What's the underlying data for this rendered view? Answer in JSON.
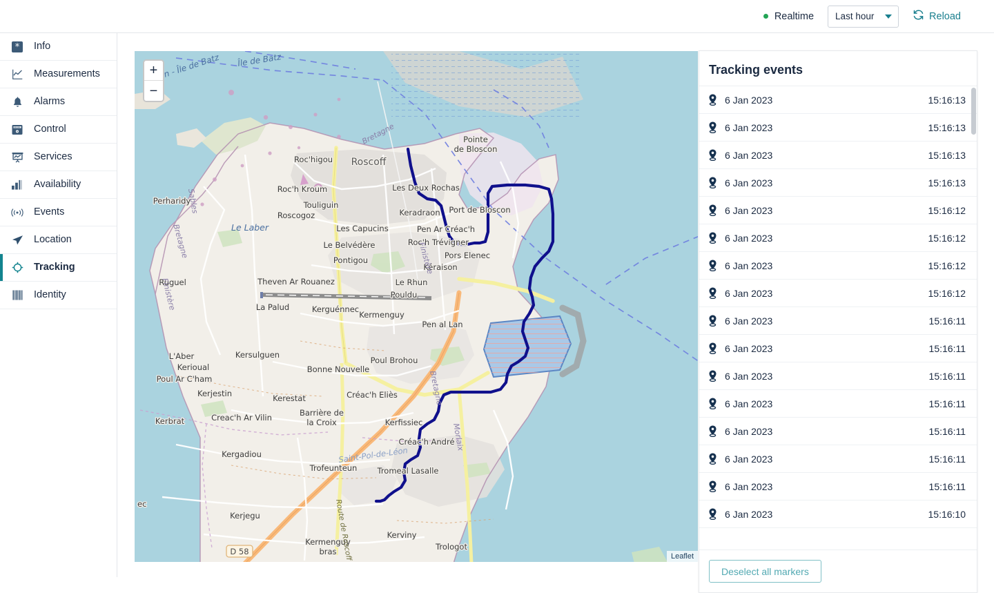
{
  "topbar": {
    "realtime_label": "Realtime",
    "realtime_status_color": "#23a455",
    "time_range_value": "Last hour",
    "reload_label": "Reload",
    "accent_color": "#1a7f8e"
  },
  "sidebar": {
    "active_item": "Tracking",
    "items": [
      {
        "label": "Info",
        "icon": "info-asterisk-icon"
      },
      {
        "label": "Measurements",
        "icon": "line-chart-icon"
      },
      {
        "label": "Alarms",
        "icon": "bell-icon"
      },
      {
        "label": "Control",
        "icon": "control-panel-icon"
      },
      {
        "label": "Services",
        "icon": "services-board-icon"
      },
      {
        "label": "Availability",
        "icon": "bar-chart-icon"
      },
      {
        "label": "Events",
        "icon": "broadcast-icon"
      },
      {
        "label": "Location",
        "icon": "paper-plane-icon"
      },
      {
        "label": "Tracking",
        "icon": "crosshair-icon"
      },
      {
        "label": "Identity",
        "icon": "barcode-icon"
      }
    ]
  },
  "map": {
    "zoom_in_label": "+",
    "zoom_out_label": "−",
    "attribution": "Leaflet",
    "track_color": "#10108c",
    "water_color": "#aad3df",
    "land_color": "#f2efe9",
    "labels": [
      "Île de Batz",
      "Île de Batz",
      "Pointe",
      "de Bloscon",
      "Roc'higou",
      "Roscoff",
      "Les Deux Rochas",
      "Port de Bloscon",
      "Roc'h Kroum",
      "Keradraon",
      "Touliguin",
      "Pen Ar Créac'h",
      "Roscogoz",
      "Les Capucins",
      "Roc'h Trévigner",
      "Perharidy",
      "Le Belvédère",
      "Pors Elenec",
      "Le Laber",
      "Pontigou",
      "Kéraison",
      "Ruguel",
      "Theven Ar Rouanez",
      "Le Rhun",
      "Pouldu",
      "La Palud",
      "Kerguénnec",
      "Kermenguy",
      "Pen al Lan",
      "Bretagne",
      "Finistère",
      "L'Aber",
      "Kersulguen",
      "Poul Brohou",
      "Kerioual",
      "Bonne Nouvelle",
      "Poul Ar C'ham",
      "Kerjestin",
      "Créac'h Eliès",
      "Kerestat",
      "Barrière de",
      "la Croix",
      "Kerbrat",
      "Creac'h Ar Vilin",
      "Kerfissiec",
      "Morlaix",
      "Kergadiou",
      "Créac'h André",
      "Saint-Pol-de-Léon",
      "Trofeunteun",
      "Tromeal Lasalle",
      "Kerjegu",
      "Route de Roscoff",
      "D 58",
      "Kerviny",
      "Kermenguy",
      "bras",
      "Trologot",
      "Sables"
    ]
  },
  "events_panel": {
    "title": "Tracking events",
    "deselect_button_label": "Deselect all markers",
    "marker_icon": "location-pin-icon",
    "rows": [
      {
        "date": "6 Jan 2023",
        "time": "15:16:13"
      },
      {
        "date": "6 Jan 2023",
        "time": "15:16:13"
      },
      {
        "date": "6 Jan 2023",
        "time": "15:16:13"
      },
      {
        "date": "6 Jan 2023",
        "time": "15:16:13"
      },
      {
        "date": "6 Jan 2023",
        "time": "15:16:12"
      },
      {
        "date": "6 Jan 2023",
        "time": "15:16:12"
      },
      {
        "date": "6 Jan 2023",
        "time": "15:16:12"
      },
      {
        "date": "6 Jan 2023",
        "time": "15:16:12"
      },
      {
        "date": "6 Jan 2023",
        "time": "15:16:11"
      },
      {
        "date": "6 Jan 2023",
        "time": "15:16:11"
      },
      {
        "date": "6 Jan 2023",
        "time": "15:16:11"
      },
      {
        "date": "6 Jan 2023",
        "time": "15:16:11"
      },
      {
        "date": "6 Jan 2023",
        "time": "15:16:11"
      },
      {
        "date": "6 Jan 2023",
        "time": "15:16:11"
      },
      {
        "date": "6 Jan 2023",
        "time": "15:16:11"
      },
      {
        "date": "6 Jan 2023",
        "time": "15:16:10"
      }
    ]
  }
}
